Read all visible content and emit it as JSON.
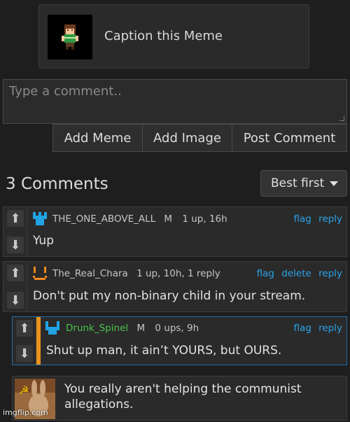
{
  "caption": {
    "label": "Caption this Meme",
    "thumb_icon": "pixel-character-icon"
  },
  "comment_input": {
    "placeholder": "Type a comment.."
  },
  "buttons": {
    "add_meme": "Add Meme",
    "add_image": "Add Image",
    "post_comment": "Post Comment"
  },
  "comments_header": {
    "count_label": "3 Comments",
    "sort_label": "Best first"
  },
  "comments": [
    {
      "user": "THE_ONE_ABOVE_ALL",
      "mod": "M",
      "stats": "1 up, 16h",
      "actions": [
        "flag",
        "reply"
      ],
      "text": "Yup",
      "avatar_color": "#21a3e6",
      "user_color": "#c6c6c6"
    },
    {
      "user": "The_Real_Chara",
      "stats": "1 up, 10h, 1 reply",
      "actions": [
        "flag",
        "delete",
        "reply"
      ],
      "text": "Don't put my non-binary child in your stream.",
      "avatar_color": "#f08a1c",
      "user_color": "#c6c6c6"
    },
    {
      "user": "Drunk_Spinel",
      "mod": "M",
      "stats": "0 ups, 9h",
      "actions": [
        "flag",
        "reply"
      ],
      "text": "Shut up man, it ain’t YOURS, but OURS.",
      "avatar_color": "#21a3e6",
      "user_color": "#4cc24c"
    }
  ],
  "image_comment": {
    "text_line1": "You really aren't helping the communist",
    "text_line2": "allegations."
  },
  "watermark": "imgflip.com",
  "colors": {
    "link": "#2aa4e8",
    "op_bar": "#e8931f",
    "background": "#1e1e1e"
  }
}
